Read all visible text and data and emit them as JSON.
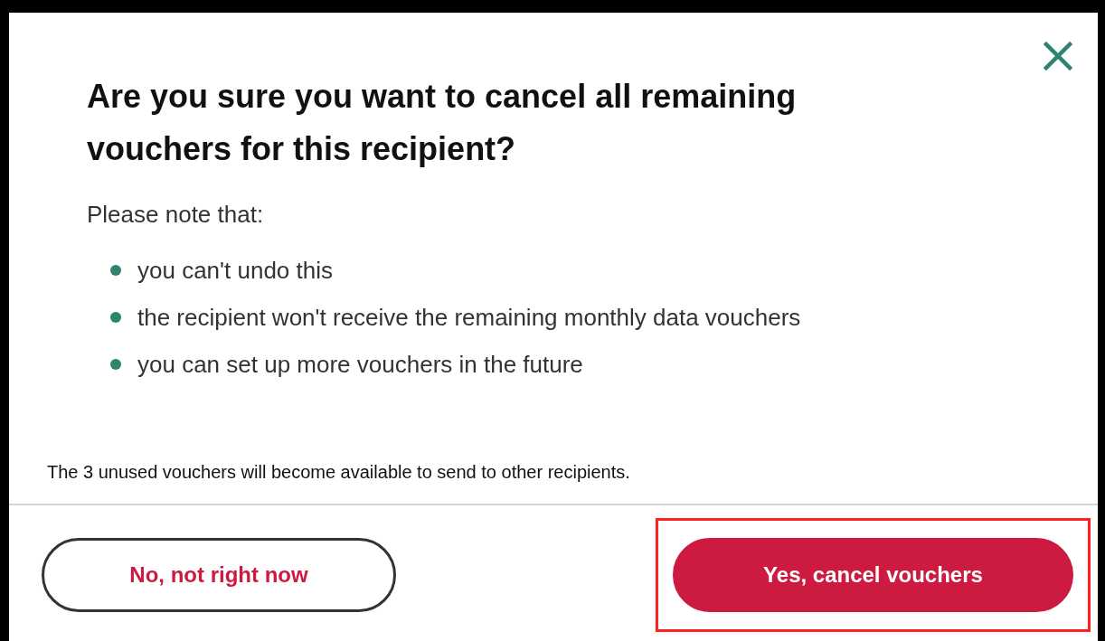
{
  "dialog": {
    "title": "Are you sure you want to cancel all remaining vouchers for this recipient?",
    "intro": "Please note that:",
    "points": [
      "you can't undo this",
      "the recipient won't receive the remaining monthly data vouchers",
      "you can set up more vouchers in the future"
    ],
    "note": "The 3 unused vouchers will become available to send to other recipients.",
    "buttons": [
      {
        "label": "No, not right now",
        "kind": "secondary",
        "highlighted": false
      },
      {
        "label": "Yes, cancel vouchers",
        "kind": "primary",
        "highlighted": true
      }
    ]
  }
}
